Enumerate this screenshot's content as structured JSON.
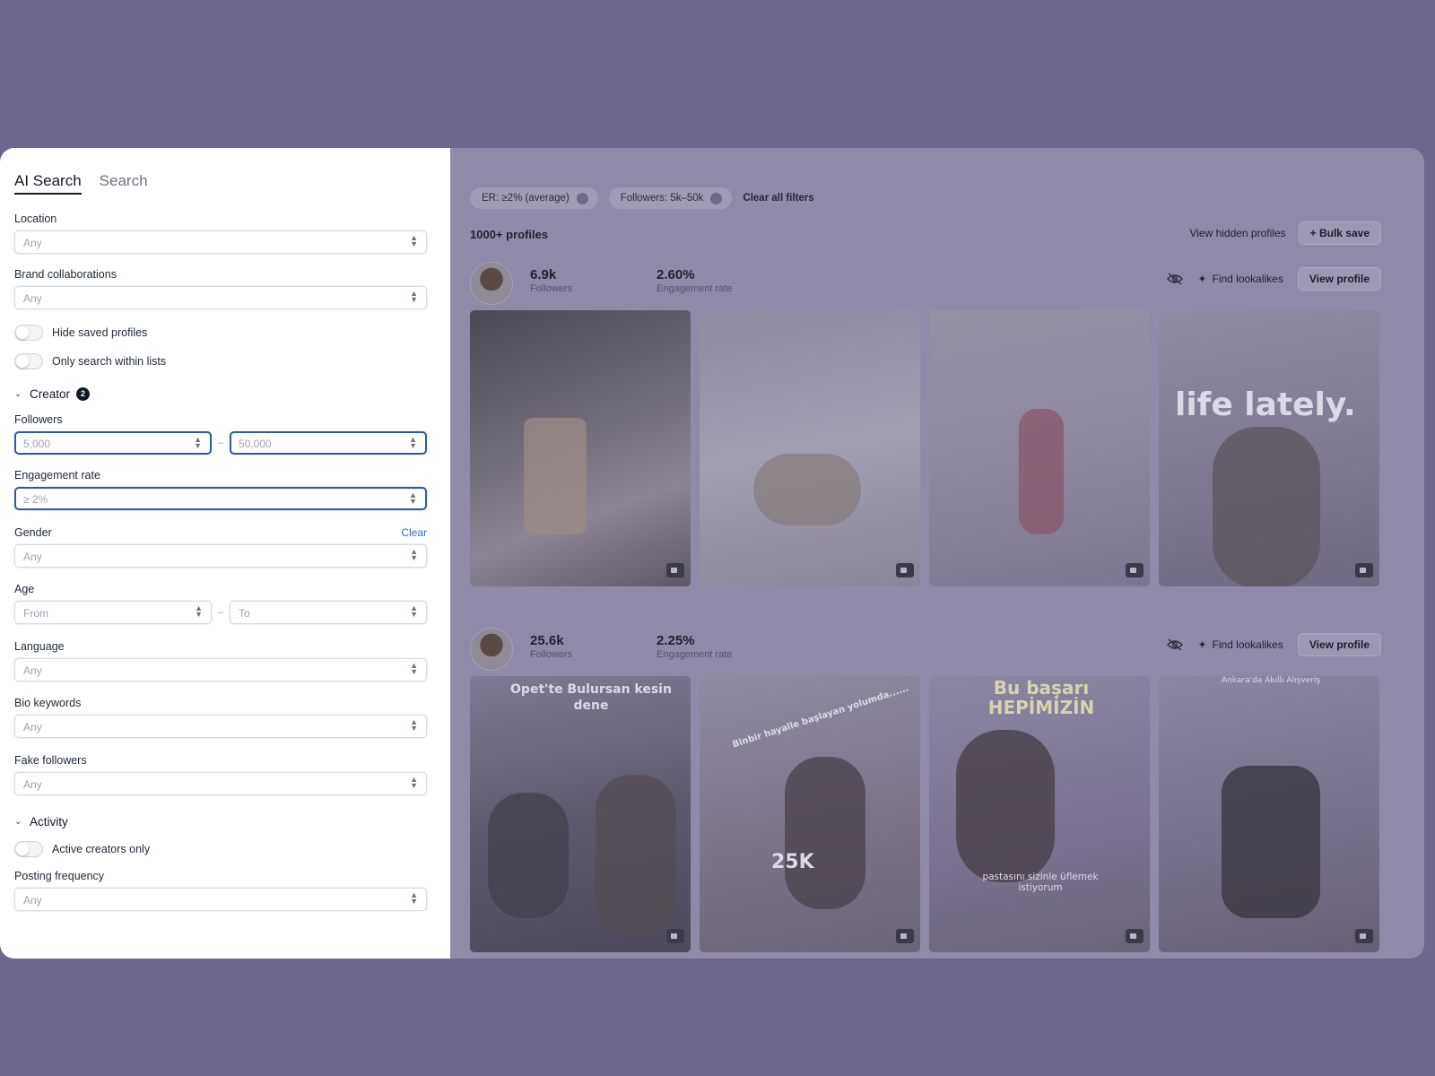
{
  "sidebar": {
    "tabs": [
      {
        "label": "AI Search",
        "active": true
      },
      {
        "label": "Search",
        "active": false
      }
    ],
    "location": {
      "label": "Location",
      "value": "Any"
    },
    "brand_collaborations": {
      "label": "Brand collaborations",
      "value": "Any"
    },
    "hide_saved": {
      "label": "Hide saved profiles",
      "on": false
    },
    "only_lists": {
      "label": "Only search within lists",
      "on": false
    },
    "creator_section": {
      "label": "Creator",
      "badge": "2"
    },
    "followers": {
      "label": "Followers",
      "from": "5,000",
      "to": "50,000"
    },
    "engagement_rate": {
      "label": "Engagement rate",
      "value": "≥ 2%"
    },
    "gender": {
      "label": "Gender",
      "clear": "Clear",
      "value": "Any"
    },
    "age": {
      "label": "Age",
      "from": "From",
      "to": "To"
    },
    "language": {
      "label": "Language",
      "value": "Any"
    },
    "bio_keywords": {
      "label": "Bio keywords",
      "value": "Any"
    },
    "fake_followers": {
      "label": "Fake followers",
      "value": "Any"
    },
    "activity_section": {
      "label": "Activity"
    },
    "active_only": {
      "label": "Active creators only",
      "on": false
    },
    "posting_frequency": {
      "label": "Posting frequency",
      "value": "Any"
    },
    "range_dash": "–"
  },
  "filters": {
    "chips": [
      "ER: ≥2% (average)",
      "Followers: 5k–50k"
    ],
    "clear_all": "Clear all filters"
  },
  "results": {
    "count": "1000+ profiles",
    "view_hidden": "View hidden profiles",
    "bulk_save": "+ Bulk save"
  },
  "profiles": [
    {
      "followers": "6.9k",
      "followers_label": "Followers",
      "engagement": "2.60%",
      "engagement_label": "Engagement rate",
      "find_lookalikes": "Find lookalikes",
      "view_profile": "View profile",
      "tile_text": [
        "",
        "",
        "",
        "life lately."
      ]
    },
    {
      "followers": "25.6k",
      "followers_label": "Followers",
      "engagement": "2.25%",
      "engagement_label": "Engagement rate",
      "find_lookalikes": "Find lookalikes",
      "view_profile": "View profile",
      "tile_text": [
        "Opet'te Bulursan kesin dene",
        "Binbir hayalle başlayan yolumda......",
        "Bu başarı HEPİMİZİN",
        "Ankara'da Akıllı Alışveriş"
      ],
      "tile_caption": "pastasını sizinle üflemek istiyorum",
      "tile_cake": "25K"
    }
  ],
  "colors": {
    "accent": "#2f5aa0",
    "backdrop": "#6f668f",
    "link": "#2f6fb4"
  }
}
